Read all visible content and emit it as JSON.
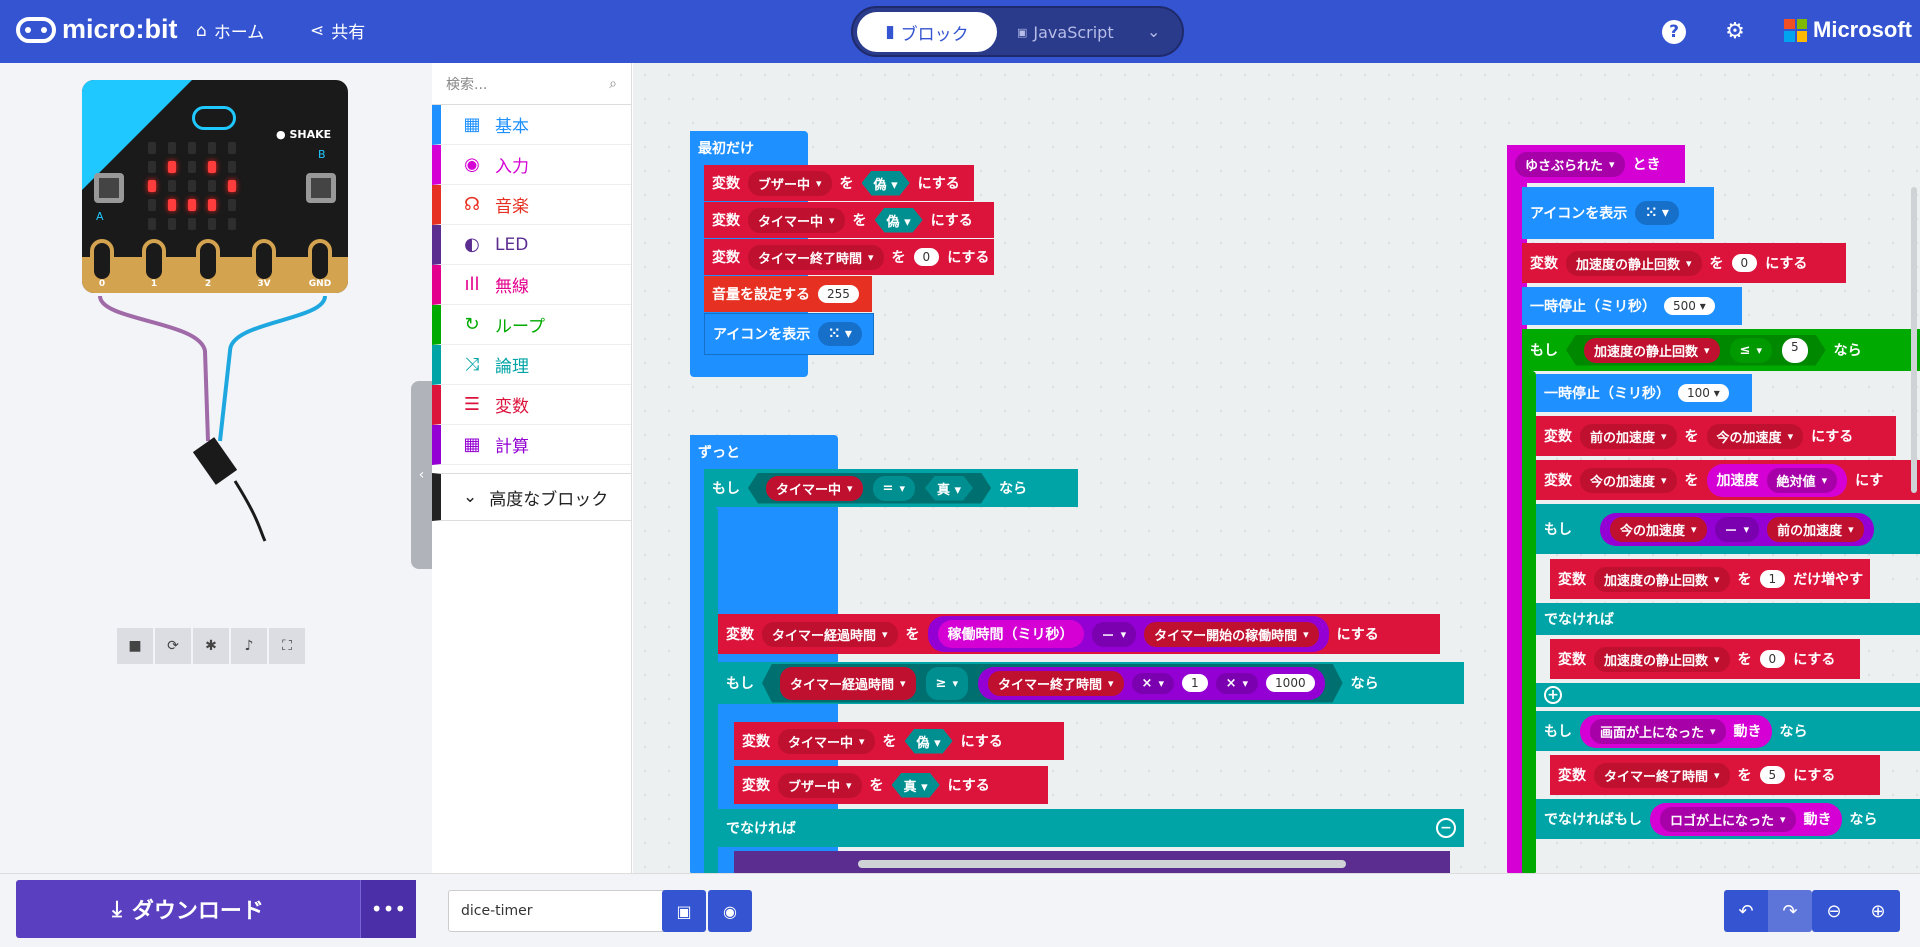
{
  "header": {
    "brand": "micro:bit",
    "home_label": "ホーム",
    "share_label": "共有",
    "mode_blocks": "ブロック",
    "mode_js": "JavaScript",
    "ms_brand": "Microsoft"
  },
  "simulator": {
    "shake_label": "SHAKE",
    "pins": [
      "0",
      "1",
      "2",
      "3V",
      "GND"
    ],
    "button_a": "A",
    "button_b": "B"
  },
  "toolbox": {
    "search_placeholder": "検索...",
    "categories": [
      {
        "label": "基本",
        "color": "#1e90ff"
      },
      {
        "label": "入力",
        "color": "#d400d4"
      },
      {
        "label": "音楽",
        "color": "#e63022"
      },
      {
        "label": "LED",
        "color": "#5c2d91"
      },
      {
        "label": "無線",
        "color": "#e3008c"
      },
      {
        "label": "ループ",
        "color": "#00aa00"
      },
      {
        "label": "論理",
        "color": "#00a4a6"
      },
      {
        "label": "変数",
        "color": "#dc143c"
      },
      {
        "label": "計算",
        "color": "#9400d3"
      }
    ],
    "advanced": "高度なブロック"
  },
  "workspace": {
    "on_start": {
      "hat": "最初だけ",
      "var": "変数",
      "set": "を",
      "to": "にする",
      "buzzer": "ブザー中",
      "timer": "タイマー中",
      "timer_end": "タイマー終了時間",
      "false": "偽",
      "zero": "0",
      "volume": "音量を設定する",
      "volume_val": "255",
      "show_icon": "アイコンを表示"
    },
    "forever": {
      "hat": "ずっと",
      "if": "もし",
      "then": "なら",
      "eq": "=",
      "true": "真",
      "elapsed": "タイマー経過時間",
      "running": "稼働時間（ミリ秒）",
      "minus": "－",
      "timer_start": "タイマー開始の稼働時間",
      "gte": "≥",
      "times": "×",
      "one": "1",
      "thousand": "1000",
      "else": "でなければ"
    },
    "shake": {
      "hat": "ゆさぶられた",
      "when": "とき",
      "show_icon": "アイコンを表示",
      "accel_count": "加速度の静止回数",
      "pause": "一時停止（ミリ秒）",
      "pause_500": "500",
      "lte": "≤",
      "five": "5",
      "then_trunc": "なら",
      "pause_100": "100",
      "prev_accel": "前の加速度",
      "cur_accel": "今の加速度",
      "accel": "加速度",
      "abs": "絶対値",
      "to_trunc": "にす",
      "increase": "だけ増やす",
      "face_up": "画面が上になった",
      "motion": "動き",
      "else_if": "でなければもし",
      "logo_up": "ロゴが上になった"
    }
  },
  "footer": {
    "download": "ダウンロード",
    "more": "•••",
    "project_name": "dice-timer"
  }
}
